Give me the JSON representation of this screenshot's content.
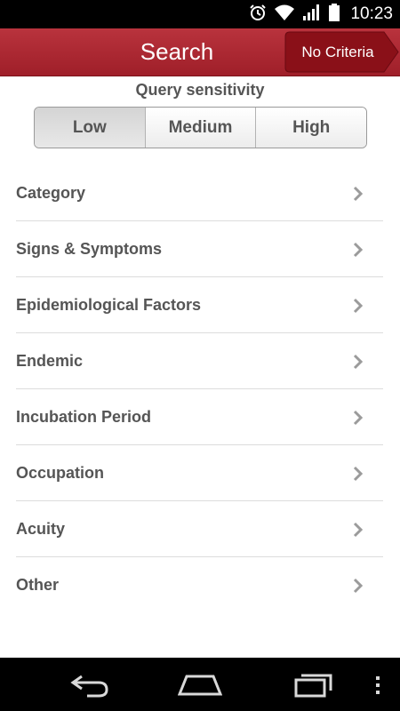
{
  "status_bar": {
    "time": "10:23",
    "icons": [
      "alarm-icon",
      "wifi-icon",
      "signal-icon",
      "battery-icon"
    ]
  },
  "header": {
    "title": "Search",
    "criteria_button": "No Criteria"
  },
  "sensitivity": {
    "label": "Query sensitivity",
    "options": [
      "Low",
      "Medium",
      "High"
    ],
    "selected": "Low"
  },
  "categories": [
    {
      "label": "Category"
    },
    {
      "label": "Signs & Symptoms"
    },
    {
      "label": "Epidemiological Factors"
    },
    {
      "label": "Endemic"
    },
    {
      "label": "Incubation Period"
    },
    {
      "label": "Occupation"
    },
    {
      "label": "Acuity"
    },
    {
      "label": "Other"
    }
  ],
  "nav_bar": {
    "icons": [
      "back-icon",
      "home-icon",
      "recent-apps-icon",
      "overflow-menu-icon"
    ]
  },
  "colors": {
    "header": "#b02a35",
    "text": "#555555",
    "status_bar": "#000000"
  }
}
